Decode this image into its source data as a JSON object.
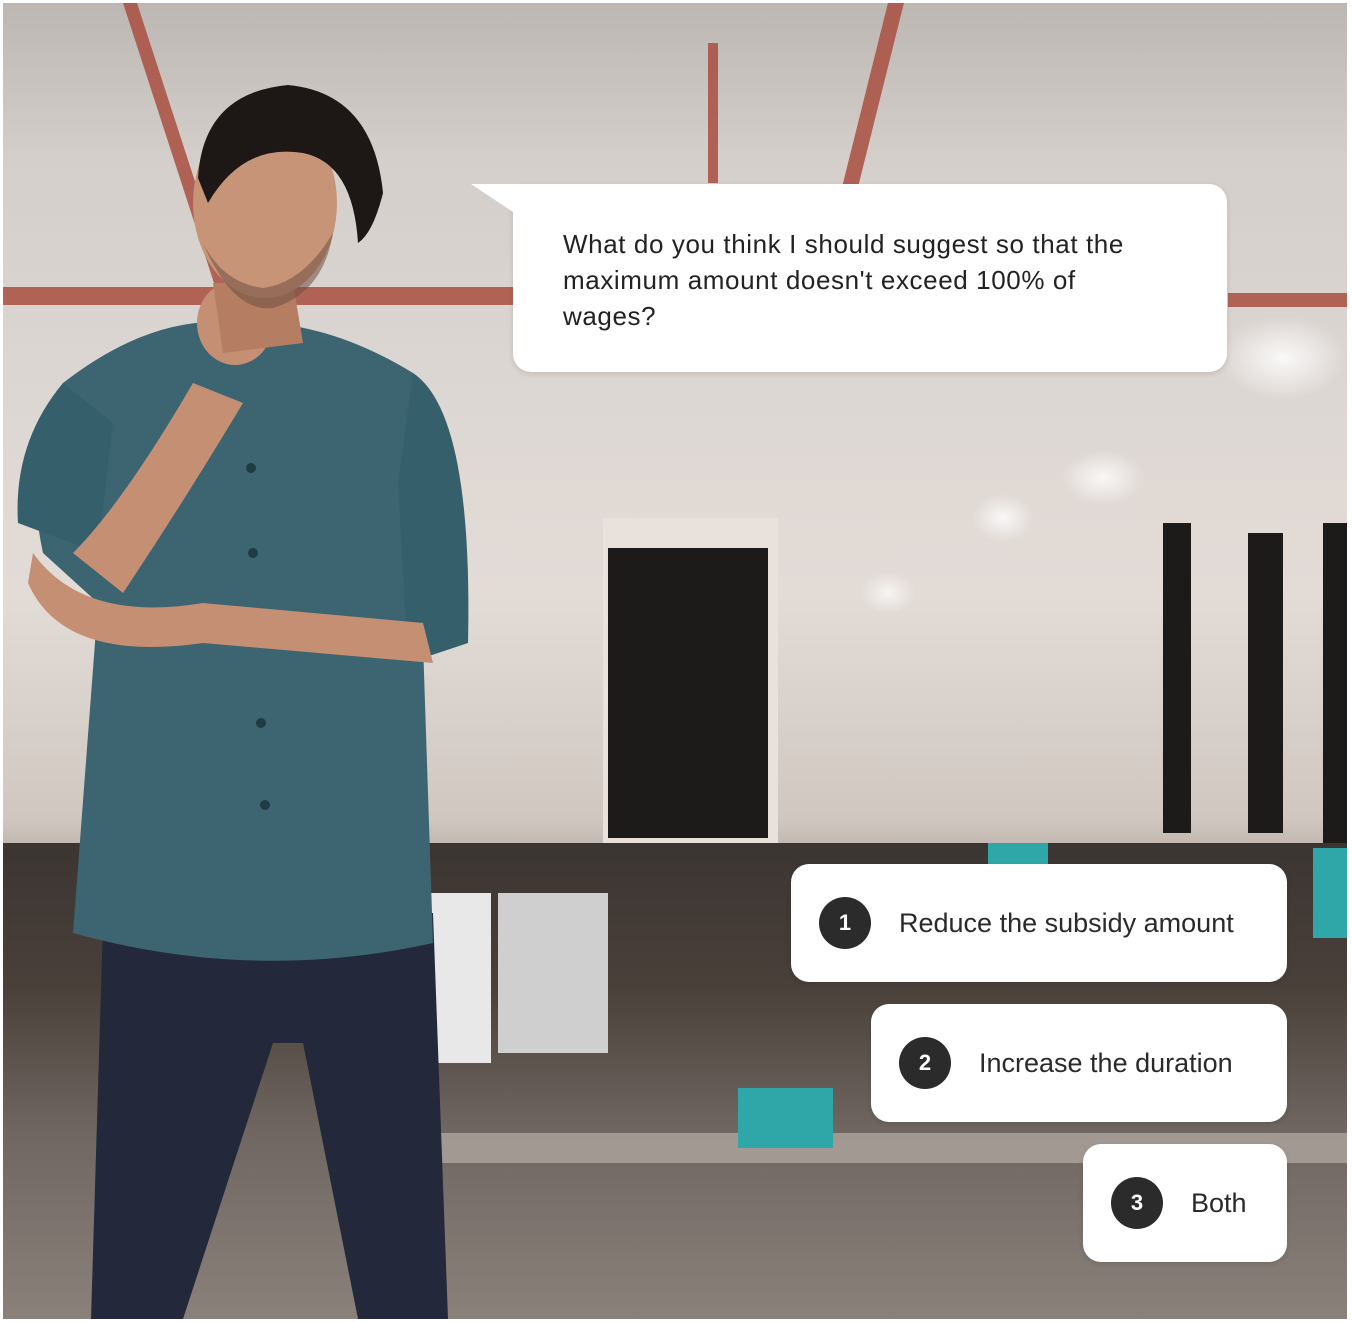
{
  "scene": {
    "background": "blurred-office-photo",
    "character": "thinking-man-in-teal-shirt"
  },
  "question": {
    "text": "What do you think I should suggest so that the maximum amount doesn't exceed 100% of wages?"
  },
  "choices": [
    {
      "number": "1",
      "label": "Reduce the subsidy amount"
    },
    {
      "number": "2",
      "label": "Increase the duration"
    },
    {
      "number": "3",
      "label": "Both"
    }
  ],
  "colors": {
    "bubble": "#ffffff",
    "badge": "#2b2b2b",
    "badge_text": "#ffffff",
    "text": "#222222",
    "shirt": "#3c6571",
    "jeans": "#23293a"
  }
}
